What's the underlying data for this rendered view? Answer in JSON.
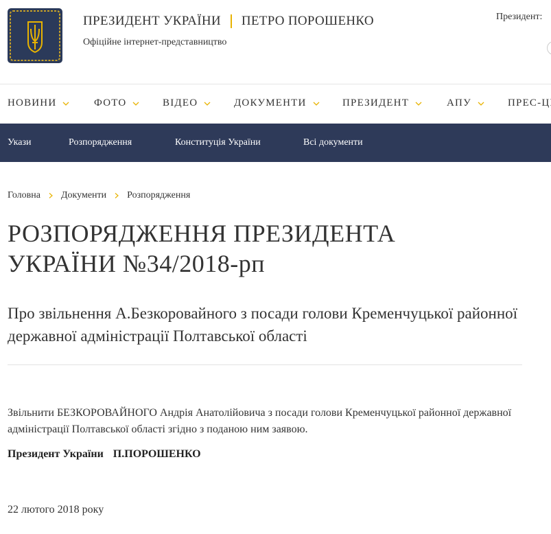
{
  "header": {
    "title_left": "ПРЕЗИДЕНТ УКРАЇНИ",
    "title_right": "ПЕТРО ПОРОШЕНКО",
    "subtitle": "Офіційне інтернет-представництво",
    "president_label": "Президент:",
    "logo_color": "#2b3a5a",
    "accent_color": "#e8b300"
  },
  "main_menu": {
    "items": [
      {
        "label": "НОВИНИ",
        "has_dropdown": true
      },
      {
        "label": "ФОТО",
        "has_dropdown": true
      },
      {
        "label": "ВІДЕО",
        "has_dropdown": true
      },
      {
        "label": "ДОКУМЕНТИ",
        "has_dropdown": true
      },
      {
        "label": "ПРЕЗИДЕНТ",
        "has_dropdown": true
      },
      {
        "label": "АПУ",
        "has_dropdown": true
      },
      {
        "label": "ПРЕС-ЦЕ",
        "has_dropdown": false
      }
    ]
  },
  "sub_nav": {
    "background": "#2e3a59",
    "items": [
      {
        "label": "Укази"
      },
      {
        "label": "Розпорядження"
      },
      {
        "label": "Конституція України"
      },
      {
        "label": "Всі документи"
      }
    ]
  },
  "breadcrumb": [
    "Головна",
    "Документи",
    "Розпорядження"
  ],
  "document": {
    "title_line1": "РОЗПОРЯДЖЕННЯ ПРЕЗИДЕНТА",
    "title_line2": "УКРАЇНИ №34/2018-рп",
    "subtitle": "Про звільнення А.Безкоровайного з посади голови Кременчуцької районної державної адміністрації Полтавської області",
    "body": "Звільнити БЕЗКОРОВАЙНОГО Андрія Анатолійовича з посади голови Кременчуцької районної державної адміністрації Полтавської області згідно з поданою ним заявою.",
    "signature_title": "Президент України",
    "signature_name": "П.ПОРОШЕНКО",
    "date": "22 лютого 2018 року"
  }
}
